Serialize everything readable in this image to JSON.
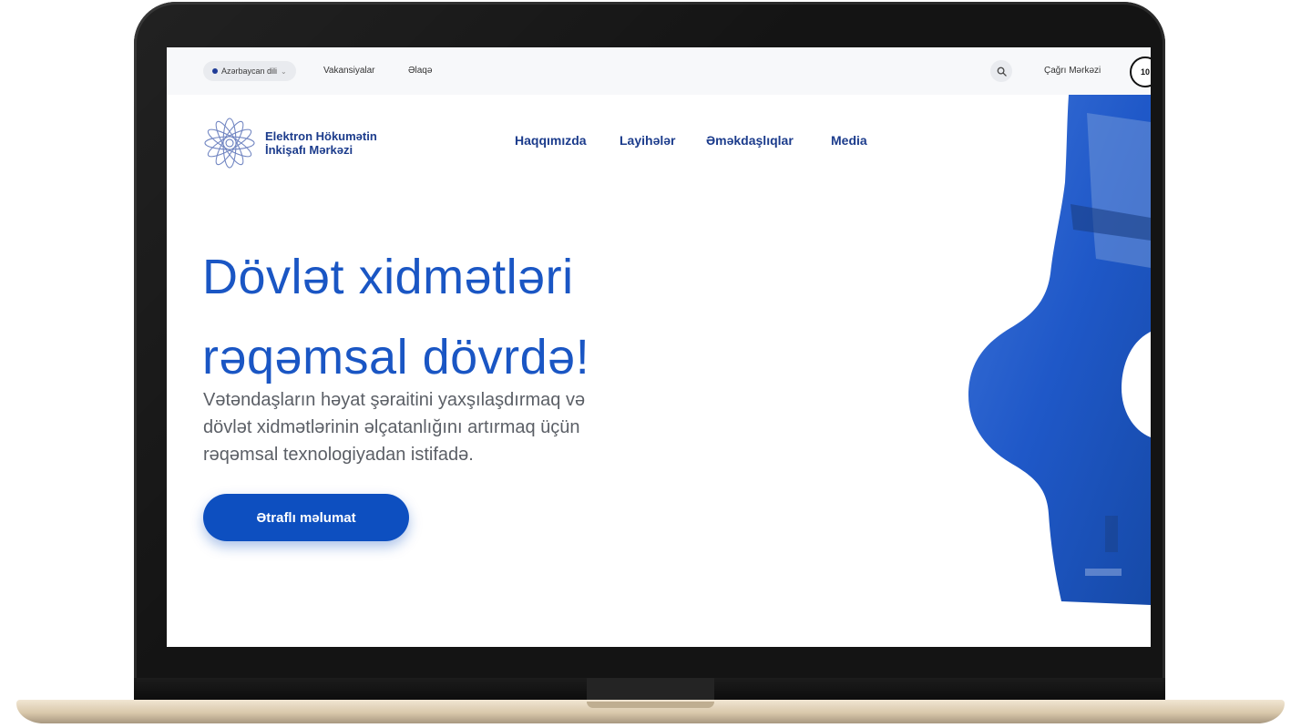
{
  "topbar": {
    "language": "Azərbaycan dili",
    "links": [
      "Vakansiyalar",
      "Əlaqə"
    ],
    "call_center": "Çağrı Mərkəzi",
    "call_number": "10"
  },
  "brand": {
    "name_line1": "Elektron Hökumətin",
    "name_line2": "İnkişafı Mərkəzi"
  },
  "nav": [
    "Haqqımızda",
    "Layihələr",
    "Əməkdaşlıqlar",
    "Media"
  ],
  "hero": {
    "title_line1": "Dövlət xidmətləri",
    "title_line2": "rəqəmsal dövrdə!",
    "subtitle_line1": "Vətəndaşların həyat şəraitini yaxşılaşdırmaq və",
    "subtitle_line2": "dövlət xidmətlərinin əlçatanlığını artırmaq üçün",
    "subtitle_line3": "rəqəmsal texnologiyadan istifadə.",
    "cta": "Ətraflı məlumat"
  },
  "colors": {
    "brand": "#1c3c8c",
    "accent": "#1a56c4",
    "button": "#0d4fc0"
  },
  "icons": {
    "search": "search-icon",
    "language": "globe-dot-icon",
    "dropdown": "chevron-down-icon"
  }
}
